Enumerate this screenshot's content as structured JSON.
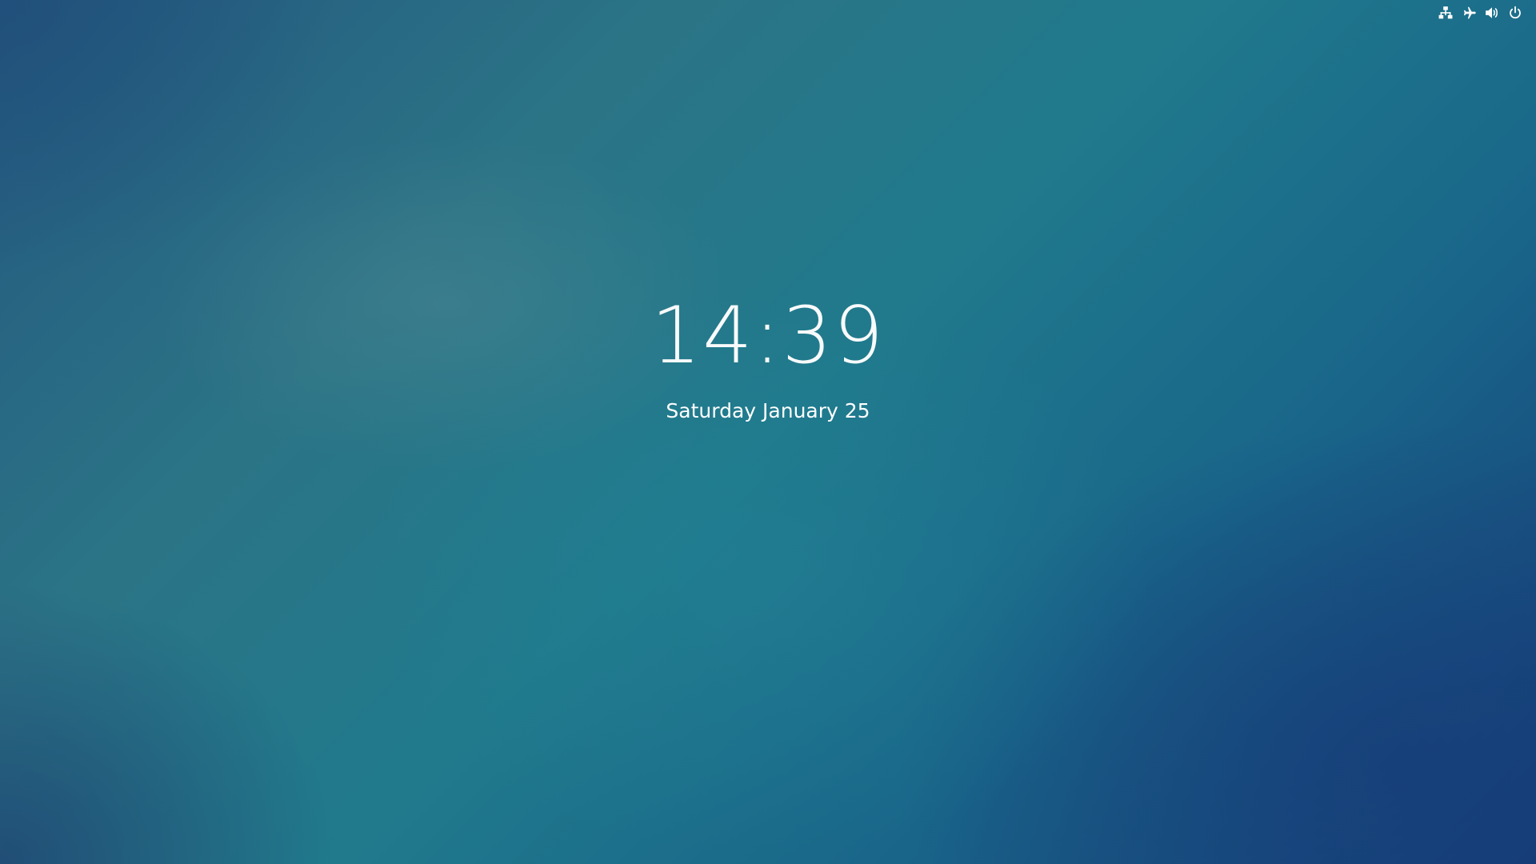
{
  "top_bar": {
    "icons": [
      {
        "name": "network-wired-icon"
      },
      {
        "name": "airplane-mode-icon"
      },
      {
        "name": "volume-icon"
      },
      {
        "name": "power-icon"
      }
    ],
    "icon_color": "#ffffff"
  },
  "clock": {
    "time": "14:39",
    "date": "Saturday January 25"
  },
  "colors": {
    "background_primary": "#1e6e86",
    "background_corner": "#173d78",
    "text": "#ffffff"
  }
}
